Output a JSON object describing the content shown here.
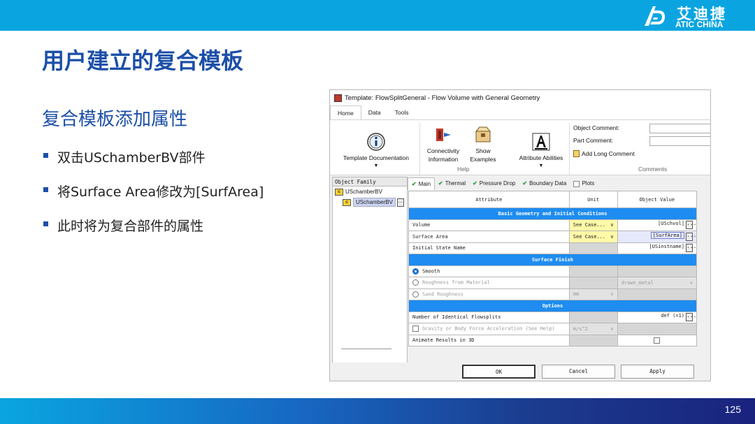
{
  "brand": {
    "name_cn": "艾迪捷",
    "name_en": "ATIC CHINA",
    "accent": "#0aa5e1"
  },
  "slide": {
    "title": "用户建立的复合模板",
    "subtitle": "复合模板添加属性",
    "bullets": [
      "双击USchamberBV部件",
      "将Surface Area修改为[SurfArea]",
      "此时将为复合部件的属性"
    ],
    "page_number": "125"
  },
  "window": {
    "title": "Template: FlowSplitGeneral - Flow Volume with General Geometry",
    "tabs": [
      "Home",
      "Data",
      "Tools"
    ],
    "ribbon": {
      "template_doc": "Template Documentation",
      "connectivity": [
        "Connectivity",
        "Information"
      ],
      "show_examples": [
        "Show",
        "Examples"
      ],
      "attribute_abilities": "Attribute Abilities",
      "help_group": "Help",
      "object_comment": "Object Comment:",
      "part_comment": "Part Comment:",
      "add_long_comment": "Add Long Comment",
      "comments_group": "Comments"
    },
    "left_pane": {
      "header": "Object Family",
      "family": "USchamberBV",
      "selected": "USchamberBV"
    },
    "detail_tabs": [
      "Main",
      "Thermal",
      "Pressure Drop",
      "Boundary Data",
      "Plots"
    ],
    "grid": {
      "headers": [
        "Attribute",
        "Unit",
        "Object Value"
      ],
      "sections": [
        "Basic Geometry and Initial Conditions",
        "Surface Finish",
        "Options"
      ],
      "rows": {
        "volume": {
          "attr": "Volume",
          "unit": "See Case...",
          "value": "[USchvol]"
        },
        "surface_area": {
          "attr": "Surface Area",
          "unit": "See Case...",
          "value": "[SurfArea]"
        },
        "initial_state": {
          "attr": "Initial State Name",
          "value": "[USinstname]"
        },
        "smooth": {
          "attr": "Smooth"
        },
        "roughness": {
          "attr": "Roughness from Material",
          "value": "drawn_metal"
        },
        "sand": {
          "attr": "Sand Roughness",
          "unit": "mm"
        },
        "flowsplits": {
          "attr": "Number of Identical Flowsplits",
          "value": "def (=1)"
        },
        "gravity": {
          "attr": "Gravity or Body Force Acceleration (See Help)",
          "unit": "m/s^2"
        },
        "animate": {
          "attr": "Animate Results in 3D"
        }
      }
    },
    "buttons": {
      "ok": "OK",
      "cancel": "Cancel",
      "apply": "Apply"
    }
  }
}
